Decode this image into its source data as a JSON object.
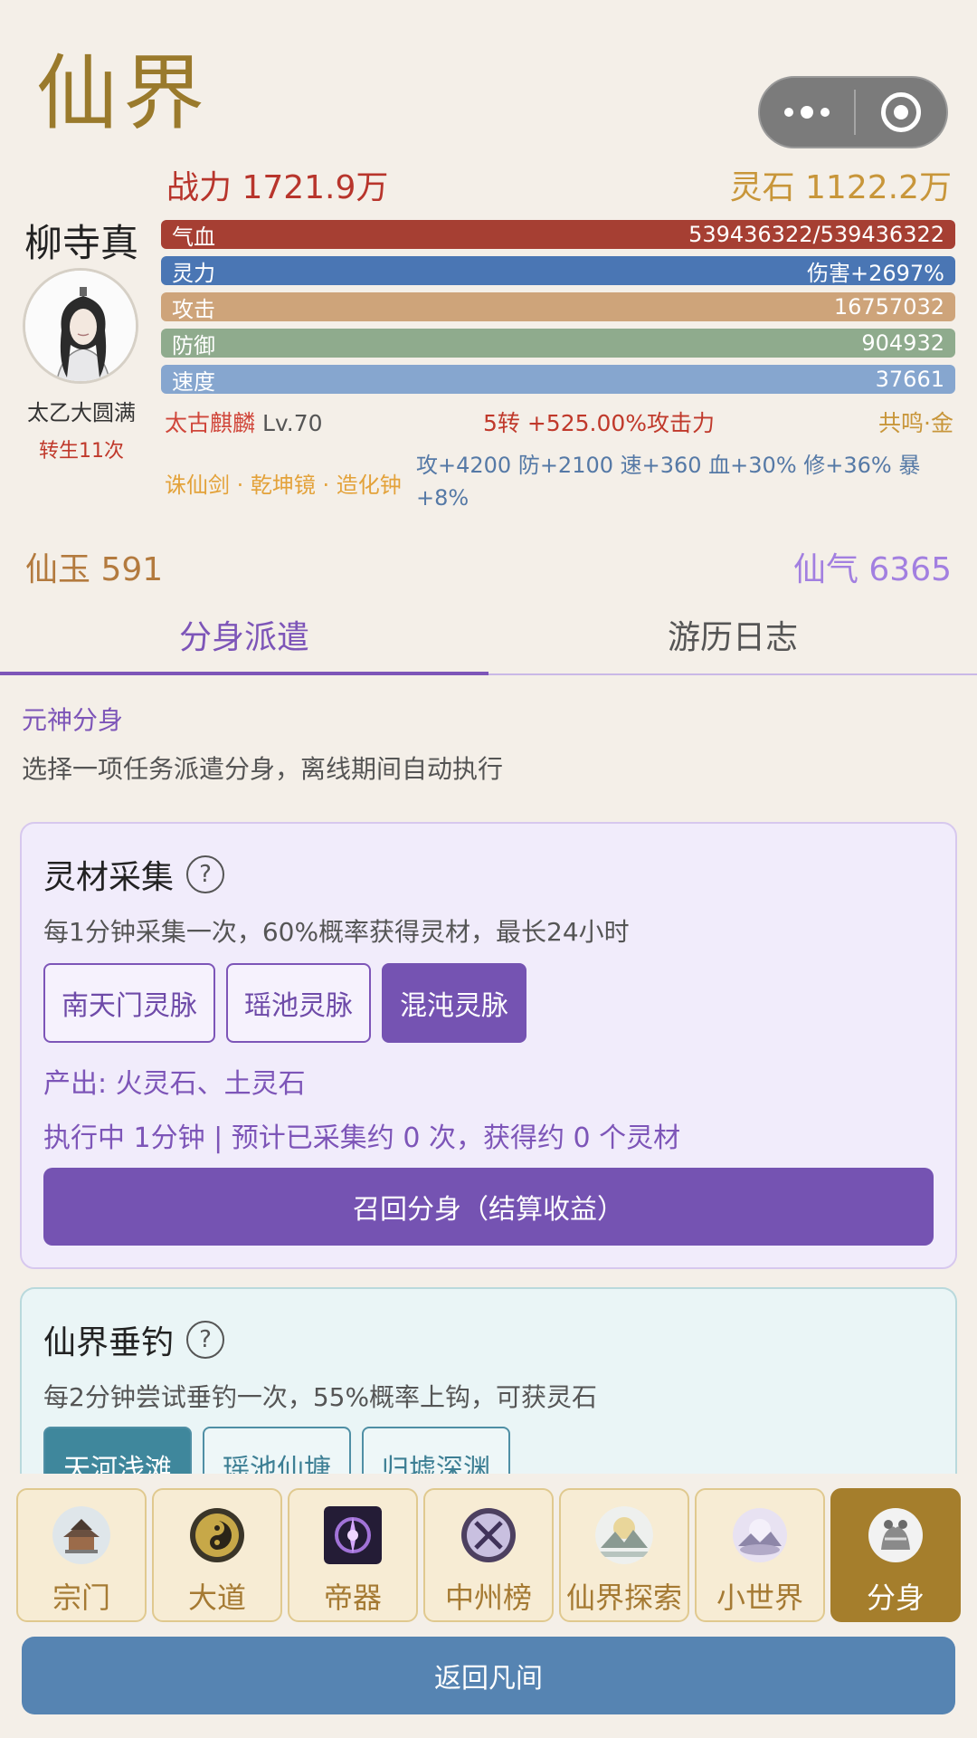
{
  "page": {
    "title": "仙界"
  },
  "capsule": {
    "more_icon": "more-dots-icon",
    "close_icon": "target-close-icon"
  },
  "header": {
    "power": "战力 1721.9万",
    "spirit_stone": "灵石 1122.2万"
  },
  "player": {
    "name": "柳寺真",
    "realm": "太乙大圆满",
    "rebirth": "转生11次"
  },
  "stats": [
    {
      "label": "气血",
      "value": "539436322/539436322",
      "color": "#a63f33"
    },
    {
      "label": "灵力",
      "value": "伤害+2697%",
      "color": "#4a76b4"
    },
    {
      "label": "攻击",
      "value": "16757032",
      "color": "#cea47a"
    },
    {
      "label": "防御",
      "value": "904932",
      "color": "#8fab8d"
    },
    {
      "label": "速度",
      "value": "37661",
      "color": "#86a6cf"
    }
  ],
  "beast": {
    "name": "太古麒麟",
    "level": "Lv.70"
  },
  "reincarnation": "5转 +525.00%攻击力",
  "resonance": "共鸣·金",
  "treasures": "诛仙剑 · 乾坤镜 · 造化钟",
  "bonus": "攻+4200 防+2100 速+360 血+30% 修+36% 暴+8%",
  "currency": {
    "jade": "仙玉 591",
    "qi": "仙气 6365"
  },
  "tabs": [
    {
      "label": "分身派遣",
      "active": true
    },
    {
      "label": "游历日志",
      "active": false
    }
  ],
  "section": {
    "title": "元神分身",
    "desc": "选择一项任务派遣分身，离线期间自动执行"
  },
  "card1": {
    "title": "灵材采集",
    "help": "?",
    "desc": "每1分钟采集一次，60%概率获得灵材，最长24小时",
    "options": [
      "南天门灵脉",
      "瑶池灵脉",
      "混沌灵脉"
    ],
    "selected_index": 2,
    "output": "产出: 火灵石、土灵石",
    "status": "执行中 1分钟 | 预计已采集约 0 次，获得约 0 个灵材",
    "recall": "召回分身（结算收益）"
  },
  "card2": {
    "title": "仙界垂钓",
    "help": "?",
    "desc": "每2分钟尝试垂钓一次，55%概率上钩，可获灵石",
    "options": [
      "天河浅滩",
      "瑶池仙塘",
      "归墟深渊"
    ],
    "selected_index": 0
  },
  "nav": [
    {
      "label": "宗门",
      "icon": "sect-temple-icon"
    },
    {
      "label": "大道",
      "icon": "taiji-bagua-icon"
    },
    {
      "label": "帝器",
      "icon": "emperor-artifact-icon"
    },
    {
      "label": "中州榜",
      "icon": "ranking-swords-icon"
    },
    {
      "label": "仙界探索",
      "icon": "explore-mountain-icon"
    },
    {
      "label": "小世界",
      "icon": "small-world-icon"
    },
    {
      "label": "分身",
      "icon": "clone-icon",
      "active": true
    }
  ],
  "back_button": "返回凡间"
}
